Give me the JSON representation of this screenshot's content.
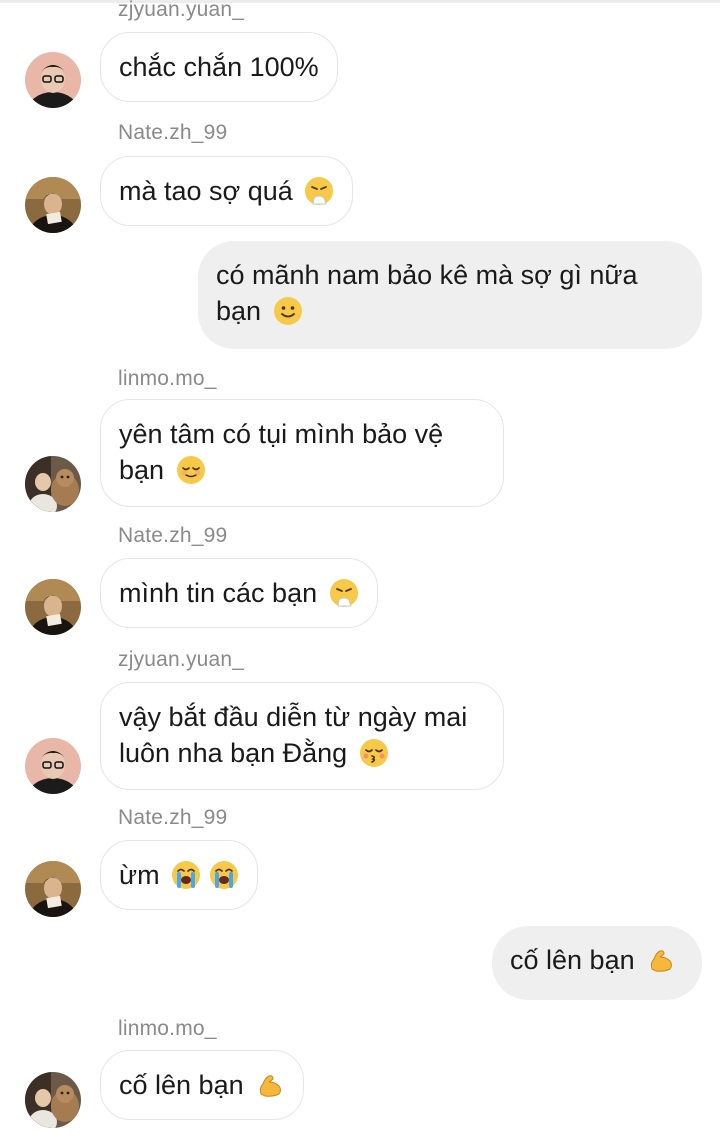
{
  "messages": [
    {
      "sender": "zjyuan.yuan_",
      "text": "chắc chắn 100%"
    },
    {
      "sender": "Nate.zh_99",
      "text": "mà tao sợ quá",
      "emoji": "sneezing-face-icon"
    },
    {
      "sender": "me",
      "lines": [
        "có mãnh nam bảo kê mà sợ gì nữa",
        "bạn"
      ],
      "emoji": "slightly-smiling-face-icon"
    },
    {
      "sender": "linmo.mo_",
      "lines": [
        "yên tâm có tụi mình bảo vệ",
        "bạn"
      ],
      "emoji": "relieved-face-icon"
    },
    {
      "sender": "Nate.zh_99",
      "text": "mình tin các bạn",
      "emoji": "sneezing-face-icon"
    },
    {
      "sender": "zjyuan.yuan_",
      "lines": [
        "vậy bắt đầu diễn từ ngày mai",
        "luôn nha bạn Đằng"
      ],
      "emoji": "kissing-face-closed-eyes-icon"
    },
    {
      "sender": "Nate.zh_99",
      "text": "ừm",
      "emoji": "loudly-crying-face-icon x2"
    },
    {
      "sender": "me",
      "text": "cố lên bạn",
      "emoji": "flexed-biceps-icon"
    },
    {
      "sender": "linmo.mo_",
      "text": "cố lên bạn",
      "emoji": "flexed-biceps-icon"
    }
  ],
  "colors": {
    "incoming_bubble": "#ffffff",
    "incoming_border": "#e6e6e6",
    "outgoing_bubble": "#efefef",
    "sender_name": "#8a8a8a",
    "text": "#1a1a1a"
  }
}
